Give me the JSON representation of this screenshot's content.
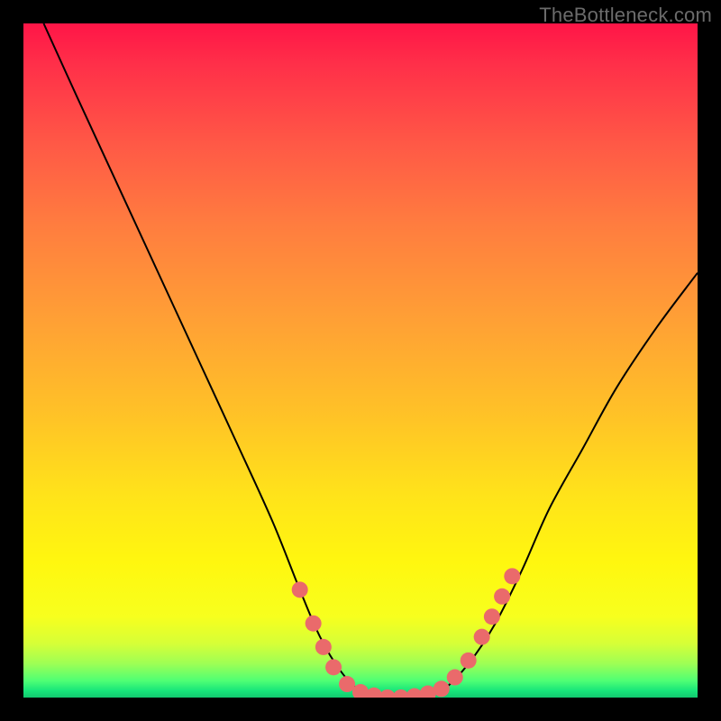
{
  "watermark": "TheBottleneck.com",
  "chart_data": {
    "type": "line",
    "title": "",
    "xlabel": "",
    "ylabel": "",
    "xlim": [
      0,
      100
    ],
    "ylim": [
      0,
      100
    ],
    "grid": false,
    "legend": false,
    "series": [
      {
        "name": "bottleneck-curve",
        "x": [
          3,
          8,
          14,
          20,
          26,
          32,
          37,
          41,
          44,
          47,
          50,
          54,
          58,
          62,
          66,
          70,
          74,
          78,
          83,
          88,
          94,
          100
        ],
        "y": [
          100,
          89,
          76,
          63,
          50,
          37,
          26,
          16,
          9,
          4,
          1,
          0,
          0,
          1,
          5,
          11,
          19,
          28,
          37,
          46,
          55,
          63
        ]
      }
    ],
    "markers": {
      "name": "highlighted-points",
      "color": "#ea6a6b",
      "points": [
        {
          "x": 41,
          "y": 16
        },
        {
          "x": 43,
          "y": 11
        },
        {
          "x": 44.5,
          "y": 7.5
        },
        {
          "x": 46,
          "y": 4.5
        },
        {
          "x": 48,
          "y": 2
        },
        {
          "x": 50,
          "y": 0.8
        },
        {
          "x": 52,
          "y": 0.3
        },
        {
          "x": 54,
          "y": 0
        },
        {
          "x": 56,
          "y": 0
        },
        {
          "x": 58,
          "y": 0.2
        },
        {
          "x": 60,
          "y": 0.6
        },
        {
          "x": 62,
          "y": 1.3
        },
        {
          "x": 64,
          "y": 3
        },
        {
          "x": 66,
          "y": 5.5
        },
        {
          "x": 68,
          "y": 9
        },
        {
          "x": 69.5,
          "y": 12
        },
        {
          "x": 71,
          "y": 15
        },
        {
          "x": 72.5,
          "y": 18
        }
      ]
    },
    "background_gradient": {
      "top": "#ff1547",
      "mid_upper": "#ff7d3f",
      "mid": "#ffe31a",
      "mid_lower": "#d6ff37",
      "bottom": "#12c96f"
    }
  }
}
